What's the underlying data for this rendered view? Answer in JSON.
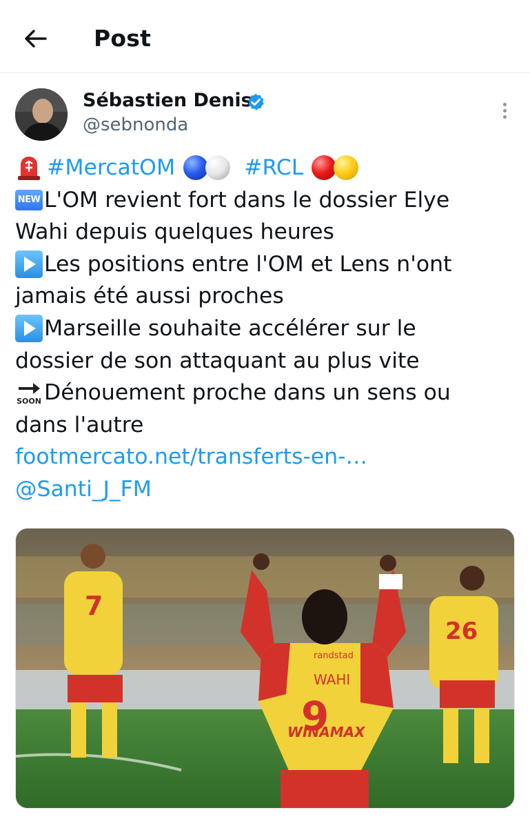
{
  "header": {
    "title": "Post"
  },
  "author": {
    "name": "Sébastien Denis",
    "handle": "@sebnonda"
  },
  "tweet": {
    "hashtag_1": "#MercatOM",
    "hashtag_2": "#RCL",
    "badge_new": "NEW",
    "line_2": "L'OM revient fort dans le dossier Elye",
    "line_3": "Wahi depuis quelques heures",
    "line_4": "Les positions entre l'OM et Lens n'ont",
    "line_5": "jamais été aussi proches",
    "line_6": "Marseille souhaite accélérer sur le",
    "line_7": "dossier de son attaquant au plus vite",
    "badge_soon": "SOON",
    "line_8": "Dénouement proche dans un sens ou",
    "line_9": "dans l'autre",
    "link": "footmercato.net/transferts-en-…",
    "mention": "@Santi_J_FM"
  },
  "media": {
    "jersey_sponsor": "randstad",
    "jersey_name": "WAHI",
    "jersey_number": "9",
    "jersey_brand": "WINAMAX",
    "left_player_number": "7",
    "right_player_number": "26"
  },
  "icons": {
    "back": "back-arrow-icon",
    "verified": "verified-badge-icon",
    "more": "more-vertical-icon"
  },
  "colors": {
    "link": "#1d9bf0",
    "text": "#0f1419",
    "muted": "#536471",
    "verified": "#1d9bf0"
  }
}
